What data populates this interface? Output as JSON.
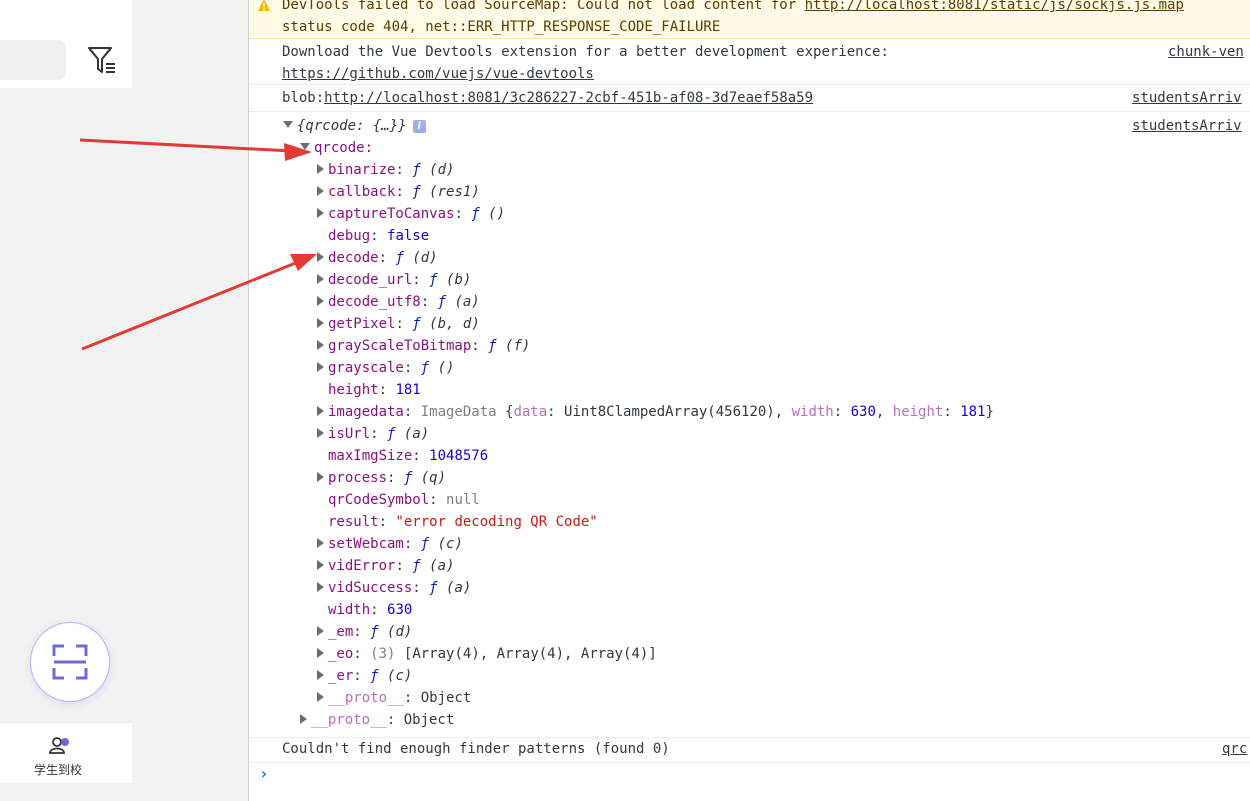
{
  "app": {
    "tab_label": "学生到校",
    "icons": {
      "filter": "filter-list-icon",
      "scan": "qr-scan-icon",
      "tab": "user-badge-icon"
    }
  },
  "console": {
    "warning": {
      "line1_prefix": "DevTools failed to load SourceMap: Could not load content for ",
      "url": "http://localhost:8081/static/js/sockjs.js.map",
      "line2": "status code 404, net::ERR_HTTP_RESPONSE_CODE_FAILURE"
    },
    "devtools_msg": {
      "line1": "Download the Vue Devtools extension for a better development experience:",
      "url": "https://github.com/vuejs/vue-devtools",
      "source": "chunk-ven"
    },
    "blob_msg": {
      "prefix": "blob:",
      "url": "http://localhost:8081/3c286227-2cbf-451b-af08-3d7eaef58a59",
      "source": "studentsArriv"
    },
    "object_msg": {
      "summary": "{qrcode: {…}}",
      "source": "studentsArriv",
      "qrcode_key": "qrcode:",
      "props": [
        {
          "key": "binarize",
          "fn": "ƒ",
          "args": "(d)",
          "expandable": true
        },
        {
          "key": "callback",
          "fn": "ƒ",
          "args": "(res1)",
          "expandable": true
        },
        {
          "key": "captureToCanvas",
          "fn": "ƒ",
          "args": "()",
          "expandable": true
        },
        {
          "key": "debug",
          "value": "false",
          "kind": "num",
          "expandable": false
        },
        {
          "key": "decode",
          "fn": "ƒ",
          "args": "(d)",
          "expandable": true
        },
        {
          "key": "decode_url",
          "fn": "ƒ",
          "args": "(b)",
          "expandable": true
        },
        {
          "key": "decode_utf8",
          "fn": "ƒ",
          "args": "(a)",
          "expandable": true
        },
        {
          "key": "getPixel",
          "fn": "ƒ",
          "args": "(b, d)",
          "expandable": true
        },
        {
          "key": "grayScaleToBitmap",
          "fn": "ƒ",
          "args": "(f)",
          "expandable": true
        },
        {
          "key": "grayscale",
          "fn": "ƒ",
          "args": "()",
          "expandable": true
        },
        {
          "key": "height",
          "value": "181",
          "kind": "num",
          "expandable": false
        },
        {
          "key": "imagedata",
          "expandable": true,
          "kind": "imagedata"
        },
        {
          "key": "isUrl",
          "fn": "ƒ",
          "args": "(a)",
          "expandable": true
        },
        {
          "key": "maxImgSize",
          "value": "1048576",
          "kind": "num",
          "expandable": false
        },
        {
          "key": "process",
          "fn": "ƒ",
          "args": "(q)",
          "expandable": true
        },
        {
          "key": "qrCodeSymbol",
          "value": "null",
          "kind": "nul",
          "expandable": false
        },
        {
          "key": "result",
          "value": "\"error decoding QR Code\"",
          "kind": "str",
          "expandable": false
        },
        {
          "key": "setWebcam",
          "fn": "ƒ",
          "args": "(c)",
          "expandable": true
        },
        {
          "key": "vidError",
          "fn": "ƒ",
          "args": "(a)",
          "expandable": true
        },
        {
          "key": "vidSuccess",
          "fn": "ƒ",
          "args": "(a)",
          "expandable": true
        },
        {
          "key": "width",
          "value": "630",
          "kind": "num",
          "expandable": false
        },
        {
          "key": "_em",
          "fn": "ƒ",
          "args": "(d)",
          "expandable": true
        },
        {
          "key": "_eo",
          "kind": "array",
          "expandable": true
        },
        {
          "key": "_er",
          "fn": "ƒ",
          "args": "(c)",
          "expandable": true
        },
        {
          "key": "__proto__",
          "value": "Object",
          "kind": "proto",
          "expandable": true
        }
      ],
      "imagedata": {
        "type": "ImageData",
        "data_label": "data",
        "data_value": "Uint8ClampedArray(456120)",
        "width_label": "width",
        "width_value": "630",
        "height_label": "height",
        "height_value": "181"
      },
      "eo": {
        "count": "(3)",
        "value": "[Array(4), Array(4), Array(4)]"
      },
      "outer_proto": {
        "key": "__proto__",
        "value": "Object"
      }
    },
    "finder_msg": {
      "text": "Couldn't find enough finder patterns (found 0)",
      "source": "qrc"
    },
    "prompt": "›"
  }
}
